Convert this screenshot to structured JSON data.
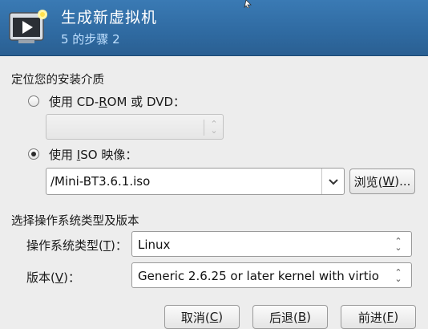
{
  "header": {
    "title": "生成新虚拟机",
    "step": "5 的步骤 2"
  },
  "install_media": {
    "section_title": "定位您的安装介质",
    "cdrom_label_prefix": "使用 CD-",
    "cdrom_label_mnemonic": "R",
    "cdrom_label_suffix": "OM 或 DVD：",
    "cdrom_selected": false,
    "iso_label_prefix": "使用 ",
    "iso_label_mnemonic": "I",
    "iso_label_suffix": "SO 映像：",
    "iso_selected": true,
    "iso_path": "/Mini-BT3.6.1.iso",
    "browse_prefix": "浏览(",
    "browse_mnemonic": "W",
    "browse_suffix": ")..."
  },
  "os": {
    "section_title": "选择操作系统类型及版本",
    "type_label_prefix": "操作系统类型(",
    "type_label_mnemonic": "T",
    "type_label_suffix": ")：",
    "type_value": "Linux",
    "version_label_prefix": "版本(",
    "version_label_mnemonic": "V",
    "version_label_suffix": ")：",
    "version_value": "Generic 2.6.25 or later kernel with virtio"
  },
  "footer": {
    "cancel_prefix": "取消(",
    "cancel_mnemonic": "C",
    "cancel_suffix": ")",
    "back_prefix": "后退(",
    "back_mnemonic": "B",
    "back_suffix": ")",
    "forward_prefix": "前进(",
    "forward_mnemonic": "F",
    "forward_suffix": ")"
  }
}
